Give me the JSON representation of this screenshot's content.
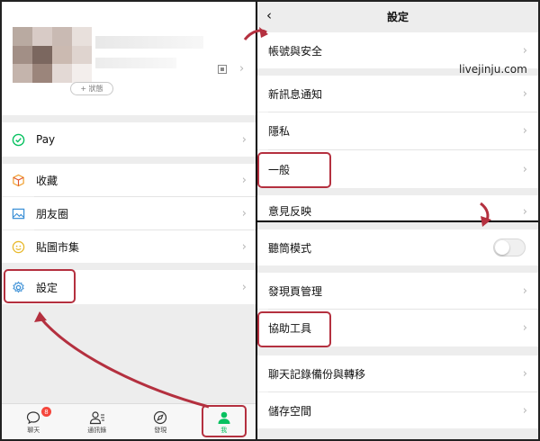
{
  "watermark": "livejinju.com",
  "left": {
    "profile": {
      "status_label": "+ 狀態"
    },
    "items": [
      {
        "label": "Pay",
        "icon": "pay-check-icon"
      },
      {
        "label": "收藏",
        "icon": "favorites-cube-icon"
      },
      {
        "label": "朋友圈",
        "icon": "moments-picture-icon"
      },
      {
        "label": "貼圖市集",
        "icon": "sticker-smile-icon"
      },
      {
        "label": "設定",
        "icon": "settings-gear-icon"
      }
    ],
    "tabbar": [
      {
        "label": "聊天",
        "icon": "chat-bubble-icon",
        "badge": "8"
      },
      {
        "label": "通訊錄",
        "icon": "contacts-icon"
      },
      {
        "label": "發現",
        "icon": "discover-compass-icon"
      },
      {
        "label": "我",
        "icon": "me-person-icon",
        "active": true
      }
    ]
  },
  "settings": {
    "title": "設定",
    "items": [
      "帳號與安全",
      "新訊息通知",
      "隱私",
      "一般",
      "意見反映"
    ]
  },
  "general": {
    "items": [
      "聽筒模式",
      "發現頁管理",
      "協助工具",
      "聊天記錄備份與轉移",
      "儲存空間"
    ]
  },
  "colors": {
    "accent": "#07c160",
    "highlight": "#b4303f",
    "badge": "#f5463c"
  }
}
